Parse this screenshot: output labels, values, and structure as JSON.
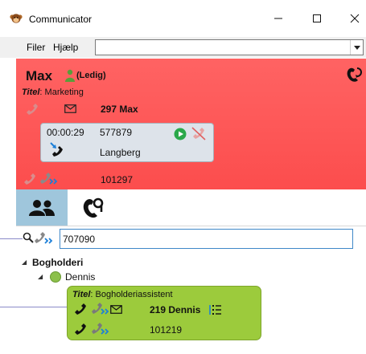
{
  "window": {
    "title": "Communicator",
    "app_icon": "monkey-icon",
    "controls": [
      "minimize-icon",
      "maximize-icon",
      "close-icon"
    ]
  },
  "menu": {
    "filer": "Filer",
    "hjaelp": "Hjælp",
    "combo_value": ""
  },
  "user_panel": {
    "name": "Max",
    "status": "(Ledig)",
    "titel_label": "Titel",
    "titel_value": ": Marketing",
    "extension": "297 Max",
    "bottom_number": "101297",
    "bg_color": "#fc5656"
  },
  "active_call": {
    "duration": "00:00:29",
    "number": "577879",
    "name": "Langberg"
  },
  "tabs": [
    {
      "name": "contacts",
      "icon": "people-icon",
      "active": true
    },
    {
      "name": "voicemail",
      "icon": "voicemail-phone-icon",
      "active": false
    }
  ],
  "search": {
    "value": "707090"
  },
  "tree": {
    "group": "Bogholderi",
    "person": "Dennis",
    "card": {
      "titel_label": "Titel",
      "titel_value": ": Bogholderiassistent",
      "extension": "219 Dennis",
      "number": "101219",
      "bg_color": "#9ccb3c"
    }
  }
}
